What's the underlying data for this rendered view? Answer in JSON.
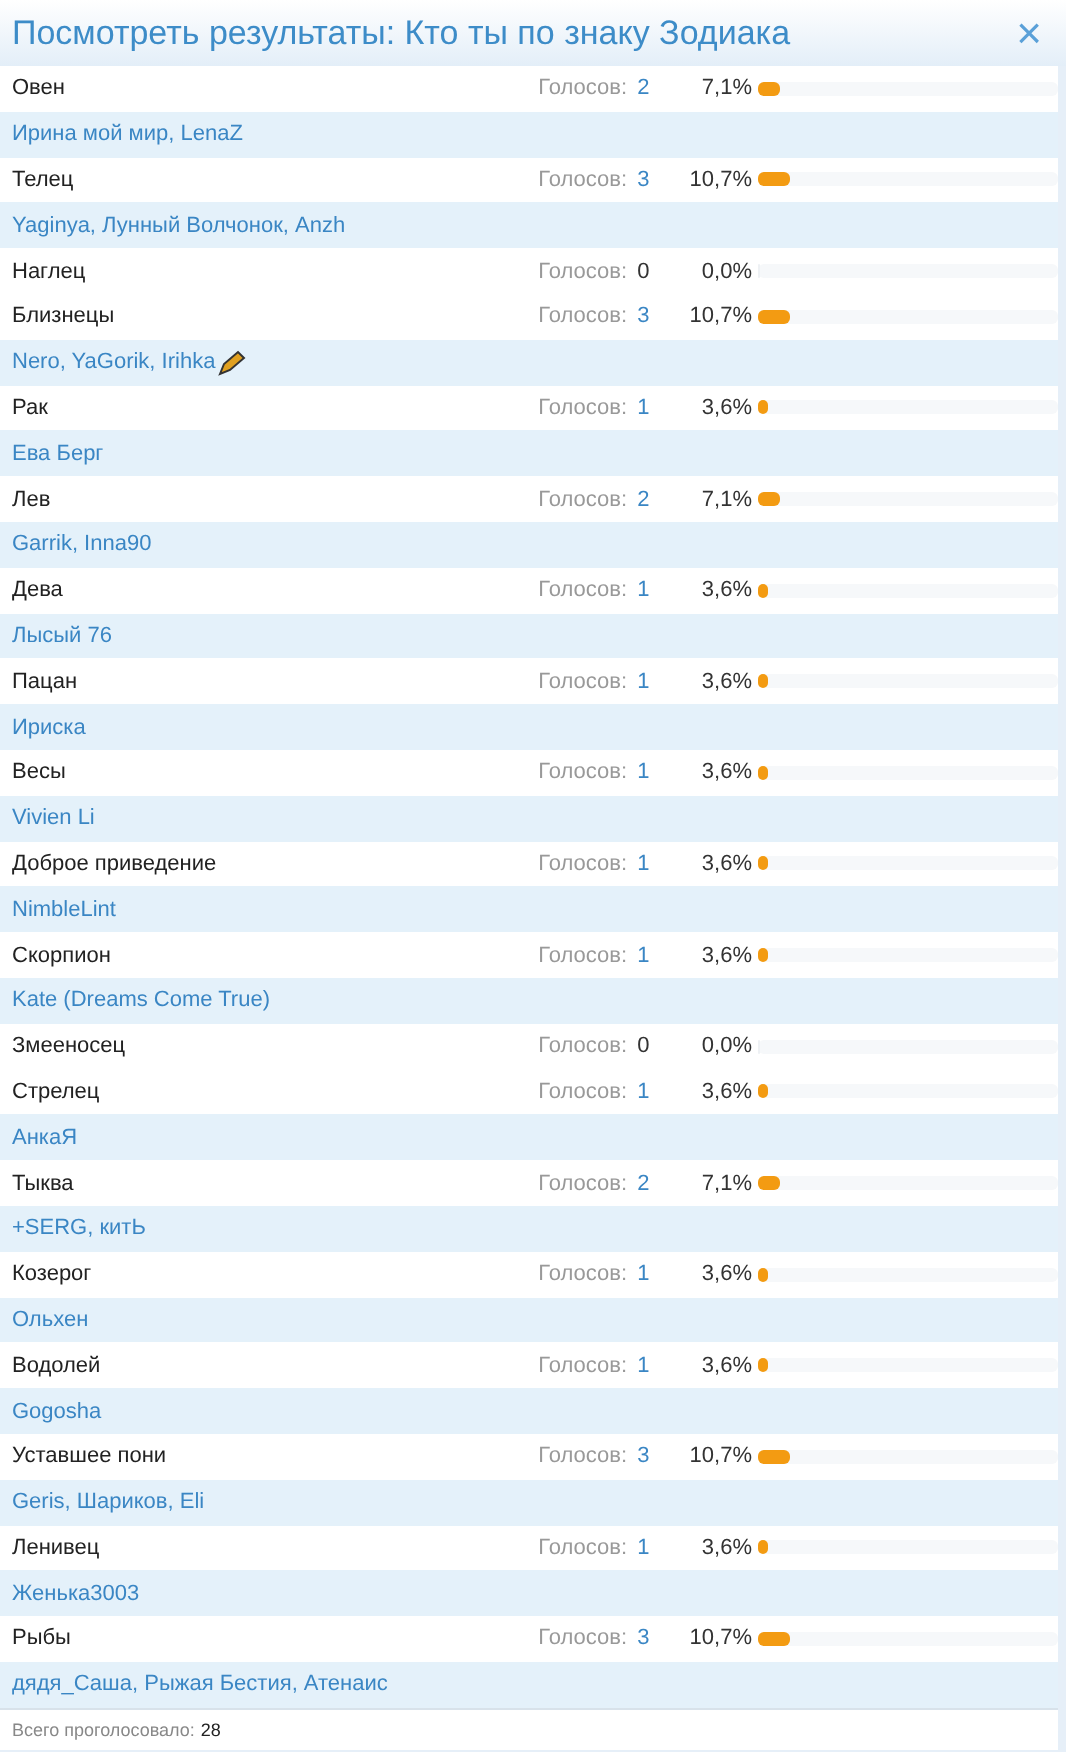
{
  "window": {
    "title": "Посмотреть результаты: Кто ты по знаку Зодиака",
    "close": "×"
  },
  "options": [
    {
      "name": "Овен",
      "votes_label": "Голосов:",
      "votes": "2",
      "percent": "7,1%",
      "level": 0.071,
      "voters": "Ирина мой мир, LenaZ"
    },
    {
      "name": "Телец",
      "votes_label": "Голосов:",
      "votes": "3",
      "percent": "10,7%",
      "level": 0.107,
      "voters": "Yaginya, Лунный Волчонок, Anzh"
    },
    {
      "name": "Наглец",
      "votes_label": "Голосов:",
      "votes": "0",
      "percent": "0,0%",
      "level": 0
    },
    {
      "name": "Близнецы",
      "votes_label": "Голосов:",
      "votes": "3",
      "percent": "10,7%",
      "level": 0.107,
      "voters": "Nero, YaGorik, Irihka",
      "badge": true
    },
    {
      "name": "Рак",
      "votes_label": "Голосов:",
      "votes": "1",
      "percent": "3,6%",
      "level": 0.036,
      "voters": "Ева Берг"
    },
    {
      "name": "Лев",
      "votes_label": "Голосов:",
      "votes": "2",
      "percent": "7,1%",
      "level": 0.071,
      "voters": "Garrik, Inna90"
    },
    {
      "name": "Дева",
      "votes_label": "Голосов:",
      "votes": "1",
      "percent": "3,6%",
      "level": 0.036,
      "voters": "Лысый 76"
    },
    {
      "name": "Пацан",
      "votes_label": "Голосов:",
      "votes": "1",
      "percent": "3,6%",
      "level": 0.036,
      "voters": "Ириска"
    },
    {
      "name": "Весы",
      "votes_label": "Голосов:",
      "votes": "1",
      "percent": "3,6%",
      "level": 0.036,
      "voters": "Vivien Li"
    },
    {
      "name": "Доброе приведение",
      "votes_label": "Голосов:",
      "votes": "1",
      "percent": "3,6%",
      "level": 0.036,
      "voters": "NimbleLint"
    },
    {
      "name": "Скорпион",
      "votes_label": "Голосов:",
      "votes": "1",
      "percent": "3,6%",
      "level": 0.036,
      "voters": "Kate (Dreams Come True)"
    },
    {
      "name": "Змееносец",
      "votes_label": "Голосов:",
      "votes": "0",
      "percent": "0,0%",
      "level": 0
    },
    {
      "name": "Стрелец",
      "votes_label": "Голосов:",
      "votes": "1",
      "percent": "3,6%",
      "level": 0.036,
      "voters": "АнкаЯ"
    },
    {
      "name": "Тыква",
      "votes_label": "Голосов:",
      "votes": "2",
      "percent": "7,1%",
      "level": 0.071,
      "voters": "+SERG, китЬ"
    },
    {
      "name": "Козерог",
      "votes_label": "Голосов:",
      "votes": "1",
      "percent": "3,6%",
      "level": 0.036,
      "voters": "Ольхен"
    },
    {
      "name": "Водолей",
      "votes_label": "Голосов:",
      "votes": "1",
      "percent": "3,6%",
      "level": 0.036,
      "voters": "Gogosha"
    },
    {
      "name": "Уставшее пони",
      "votes_label": "Голосов:",
      "votes": "3",
      "percent": "10,7%",
      "level": 0.107,
      "voters": "Geris, Шариков, Eli"
    },
    {
      "name": "Ленивец",
      "votes_label": "Голосов:",
      "votes": "1",
      "percent": "3,6%",
      "level": 0.036,
      "voters": "Женька3003"
    },
    {
      "name": "Рыбы",
      "votes_label": "Голосов:",
      "votes": "3",
      "percent": "10,7%",
      "level": 0.107,
      "voters": "дядя_Саша, Рыжая Бестия, Атенаис"
    }
  ],
  "footer": {
    "label": "Всего проголосовало:",
    "total": "28"
  }
}
